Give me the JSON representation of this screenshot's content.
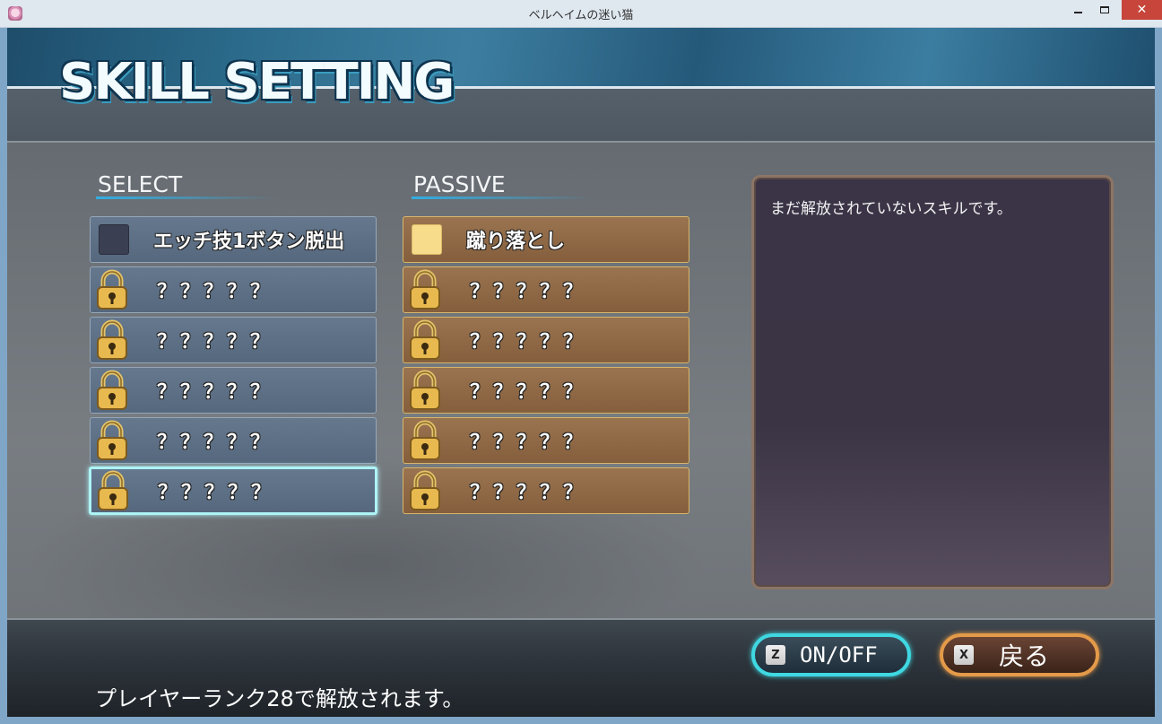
{
  "window": {
    "title": "ベルヘイムの迷い猫",
    "app_icon": "cat-app-icon"
  },
  "header": {
    "title": "SKILL SETTING"
  },
  "select": {
    "label": "SELECT",
    "items": [
      {
        "label": "エッチ技1ボタン脱出",
        "locked": false,
        "icon": "dark-square-checkbox"
      },
      {
        "label": "？？？？？",
        "locked": true,
        "icon": "padlock-icon"
      },
      {
        "label": "？？？？？",
        "locked": true,
        "icon": "padlock-icon"
      },
      {
        "label": "？？？？？",
        "locked": true,
        "icon": "padlock-icon"
      },
      {
        "label": "？？？？？",
        "locked": true,
        "icon": "padlock-icon"
      },
      {
        "label": "？？？？？",
        "locked": true,
        "icon": "padlock-icon",
        "selected": true
      }
    ]
  },
  "passive": {
    "label": "PASSIVE",
    "items": [
      {
        "label": "蹴り落とし",
        "locked": false,
        "icon": "light-square-checkbox"
      },
      {
        "label": "？？？？？",
        "locked": true,
        "icon": "padlock-icon"
      },
      {
        "label": "？？？？？",
        "locked": true,
        "icon": "padlock-icon"
      },
      {
        "label": "？？？？？",
        "locked": true,
        "icon": "padlock-icon"
      },
      {
        "label": "？？？？？",
        "locked": true,
        "icon": "padlock-icon"
      },
      {
        "label": "？？？？？",
        "locked": true,
        "icon": "padlock-icon"
      }
    ]
  },
  "description": {
    "text": "まだ解放されていないスキルです。"
  },
  "footer": {
    "message": "プレイヤーランク28で解放されます。",
    "onoff": {
      "key": "Z",
      "label": "ON/OFF"
    },
    "back": {
      "key": "X",
      "label": "戻る"
    }
  },
  "colors": {
    "select_row": "#5e7187",
    "passive_row": "#8f6946",
    "selected_border": "#aef3f6",
    "onoff_border": "#3fd8e2",
    "back_border": "#e49a49",
    "header_accent": "#33aee3"
  }
}
